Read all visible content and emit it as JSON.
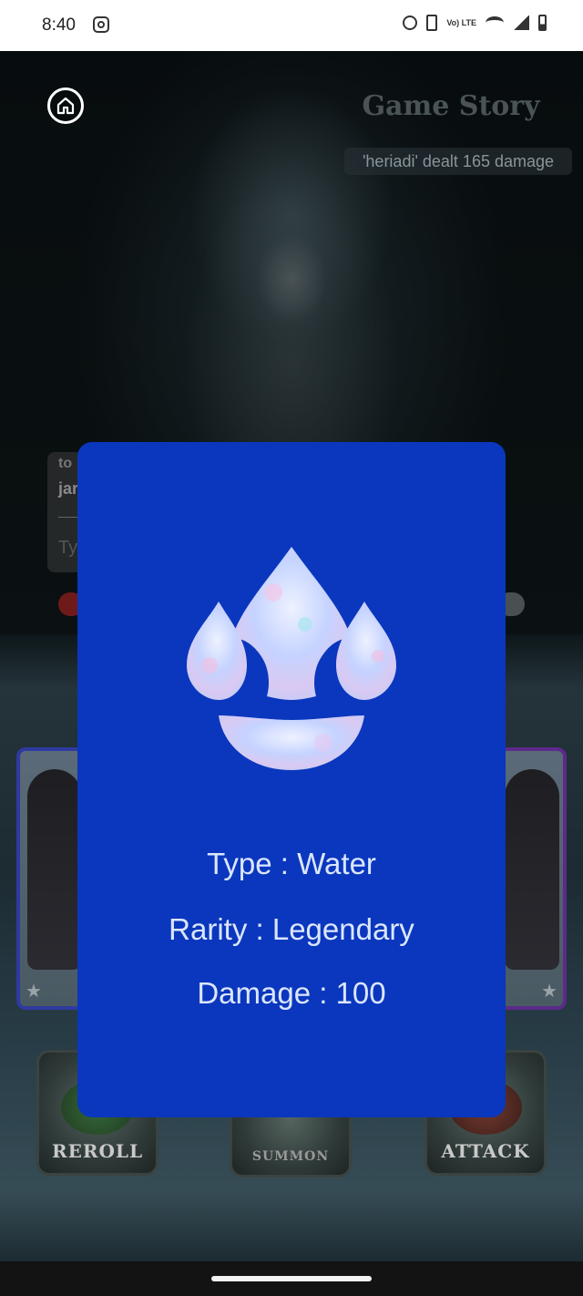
{
  "status_bar": {
    "time": "8:40",
    "icons": [
      "instagram-icon",
      "alarm-icon",
      "vibrate-icon",
      "volte-icon",
      "wifi-icon",
      "signal-icon",
      "battery-icon"
    ],
    "volte_label": "Vo) LTE"
  },
  "header": {
    "title": "Game Story",
    "log_entry": "'heriadi' dealt 165 damage"
  },
  "chat": {
    "line1": "to",
    "line2": "jar",
    "input_placeholder": "Ty"
  },
  "action_buttons": {
    "reroll": "REROLL",
    "summon": "SUMMON",
    "attack": "ATTACK"
  },
  "card_modal": {
    "icon": "water-drops-icon",
    "type_text": "Type : Water",
    "rarity_text": "Rarity : Legendary",
    "damage_text": "Damage : 100",
    "background_color": "#0a37bd",
    "text_color": "#dbe6ff"
  },
  "cards": [
    {
      "frame_color": "#2f3aa0",
      "icon": "star-icon"
    },
    {
      "frame_color": "#5b2a8a",
      "icon": "star-icon"
    }
  ]
}
